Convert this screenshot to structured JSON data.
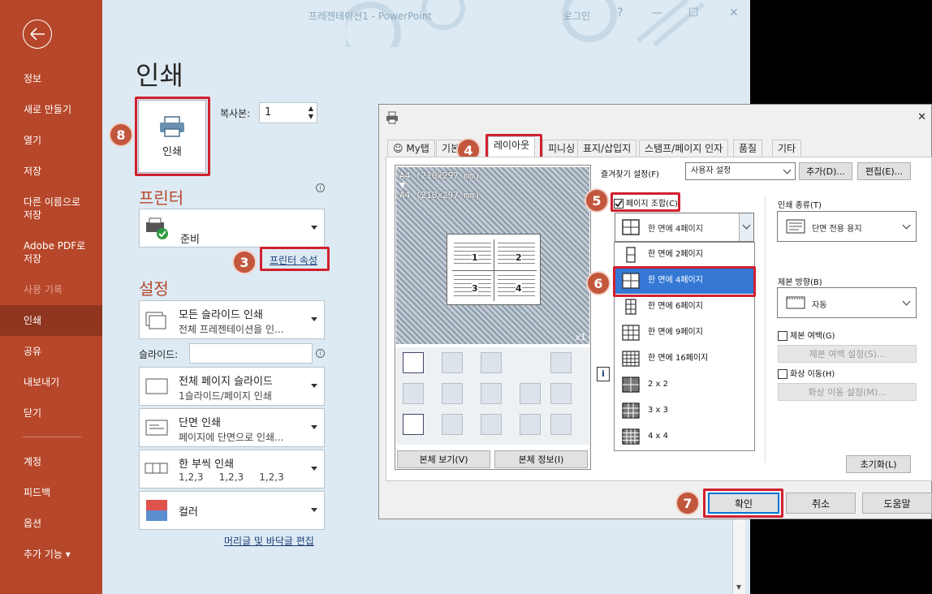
{
  "window": {
    "title": "프레젠테이션1 - PowerPoint",
    "login": "로그인",
    "help": "?",
    "min": "—",
    "max": "☐",
    "close": "✕"
  },
  "sidebar": {
    "items": [
      {
        "label": "정보"
      },
      {
        "label": "새로 만들기"
      },
      {
        "label": "열기"
      },
      {
        "label": "저장"
      },
      {
        "label": "다른 이름으로\n저장"
      },
      {
        "label": "Adobe PDF로\n저장"
      },
      {
        "label": "사용 기록"
      },
      {
        "label": "인쇄"
      },
      {
        "label": "공유"
      },
      {
        "label": "내보내기"
      },
      {
        "label": "닫기"
      },
      {
        "label": "계정"
      },
      {
        "label": "피드백"
      },
      {
        "label": "옵션"
      },
      {
        "label": "추가 기능 ▾"
      }
    ]
  },
  "print": {
    "title": "인쇄",
    "print_button": "인쇄",
    "copies_label": "복사본:",
    "copies_value": "1",
    "printer_heading": "프린터",
    "printer_status": "준비",
    "printer_props": "프린터 속성",
    "settings_heading": "설정",
    "slides_label": "슬라이드:",
    "settings": [
      {
        "t1": "모든 슬라이드 인쇄",
        "t2": "전체 프레젠테이션을 인..."
      },
      {
        "t1": "전체 페이지 슬라이드",
        "t2": "1슬라이드/페이지 인쇄"
      },
      {
        "t1": "단면 인쇄",
        "t2": "페이지에 단면으로 인쇄..."
      },
      {
        "t1": "한 부씩 인쇄",
        "t2": "1,2,3     1,2,3     1,2,3"
      },
      {
        "t1": "컬러",
        "t2": ""
      }
    ],
    "header_footer": "머리글 및 바닥글 편집"
  },
  "dialog": {
    "tabs": [
      "My탭",
      "기본",
      "레이아웃",
      "피니싱",
      "표지/삽입지",
      "스탬프/페이지 인자",
      "품질",
      "기타"
    ],
    "preview_size1": "A4 (210x297 mm)",
    "preview_size2": "A4 (210x297 mm)",
    "preview_x": "x1",
    "page_nums": [
      "1",
      "2",
      "3",
      "4"
    ],
    "view_paper": "본체 보기(V)",
    "view_info": "본체 정보(I)",
    "favorites_label": "즐겨찾기 설정(F)",
    "favorites_value": "사용자 설정",
    "add_btn": "추가(D)...",
    "edit_btn": "편집(E)...",
    "combine_label": "페이지 조합(C)",
    "combine_value": "한 면에 4페이지",
    "options": [
      "한 면에 2페이지",
      "한 면에 4페이지",
      "한 면에 6페이지",
      "한 면에 9페이지",
      "한 면에 16페이지",
      "2 x 2",
      "3 x 3",
      "4 x 4"
    ],
    "print_type_label": "인쇄 종류(T)",
    "print_type_value": "단면 전용 용지",
    "binding_label": "제본 방향(B)",
    "binding_value": "자동",
    "margin_label": "제본 여백(G)",
    "margin_btn": "제본 여백 설정(S)...",
    "shift_label": "화상 이동(H)",
    "shift_btn": "화상 이동 설정(M)...",
    "reset_btn": "초기화(L)",
    "ok": "확인",
    "cancel": "취소",
    "help": "도움말",
    "close": "✕",
    "info": "i"
  },
  "badges": [
    "8",
    "3",
    "4",
    "5",
    "6",
    "7"
  ]
}
